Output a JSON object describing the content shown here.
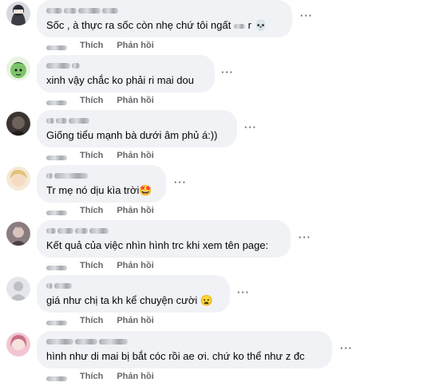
{
  "comments": [
    {
      "text": "Sốc , à thực ra sốc còn nhẹ chứ tôi ngất",
      "suffix": "r",
      "emoji": "💀",
      "like_label": "Thích",
      "reply_label": "Phản hồi",
      "avatar_color": "#3d3d46"
    },
    {
      "text": "xinh vậy chắc ko phải ri mai dou",
      "suffix": "",
      "emoji": "",
      "like_label": "Thích",
      "reply_label": "Phản hồi",
      "avatar_color": "#7cc46a"
    },
    {
      "text": "Giống tiểu mạnh bà dưới âm phủ á:))",
      "suffix": "",
      "emoji": "",
      "like_label": "Thích",
      "reply_label": "Phản hồi",
      "avatar_color": "#2d2a28"
    },
    {
      "text": "Tr mẹ nó dịu kìa trời",
      "suffix": "",
      "emoji": "🤩",
      "like_label": "Thích",
      "reply_label": "Phản hồi",
      "avatar_color": "#e9c9a5"
    },
    {
      "text": "Kết quả của việc nhìn hình trc khi xem tên page:",
      "suffix": "",
      "emoji": "",
      "like_label": "Thích",
      "reply_label": "Phản hồi",
      "avatar_color": "#6b5b60"
    },
    {
      "text": "giá như chị ta kh kể chuyện cười",
      "suffix": "",
      "emoji": "😦",
      "like_label": "Thích",
      "reply_label": "Phản hồi",
      "avatar_color": "#bcc0c4"
    },
    {
      "text": "hình như di mai bị bắt cóc rồi ae ơi. chứ ko thể như z đc",
      "suffix": "",
      "emoji": "",
      "like_label": "Thích",
      "reply_label": "Phản hồi",
      "avatar_color": "#c96f86"
    }
  ],
  "more_label": "···",
  "icons": {
    "more": "more-options-icon",
    "skull": "skull-emoji-icon",
    "star_eyes": "star-struck-emoji-icon",
    "frown": "frowning-emoji-icon"
  },
  "colors": {
    "bubble": "#f0f2f5",
    "meta_text": "#65676b",
    "text": "#050505"
  }
}
